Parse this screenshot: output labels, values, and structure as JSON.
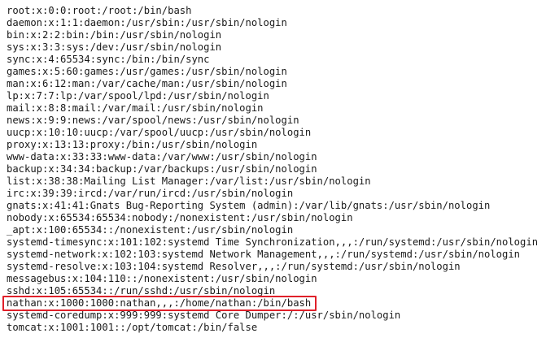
{
  "passwd_lines": [
    "root:x:0:0:root:/root:/bin/bash",
    "daemon:x:1:1:daemon:/usr/sbin:/usr/sbin/nologin",
    "bin:x:2:2:bin:/bin:/usr/sbin/nologin",
    "sys:x:3:3:sys:/dev:/usr/sbin/nologin",
    "sync:x:4:65534:sync:/bin:/bin/sync",
    "games:x:5:60:games:/usr/games:/usr/sbin/nologin",
    "man:x:6:12:man:/var/cache/man:/usr/sbin/nologin",
    "lp:x:7:7:lp:/var/spool/lpd:/usr/sbin/nologin",
    "mail:x:8:8:mail:/var/mail:/usr/sbin/nologin",
    "news:x:9:9:news:/var/spool/news:/usr/sbin/nologin",
    "uucp:x:10:10:uucp:/var/spool/uucp:/usr/sbin/nologin",
    "proxy:x:13:13:proxy:/bin:/usr/sbin/nologin",
    "www-data:x:33:33:www-data:/var/www:/usr/sbin/nologin",
    "backup:x:34:34:backup:/var/backups:/usr/sbin/nologin",
    "list:x:38:38:Mailing List Manager:/var/list:/usr/sbin/nologin",
    "irc:x:39:39:ircd:/var/run/ircd:/usr/sbin/nologin",
    "gnats:x:41:41:Gnats Bug-Reporting System (admin):/var/lib/gnats:/usr/sbin/nologin",
    "nobody:x:65534:65534:nobody:/nonexistent:/usr/sbin/nologin",
    "_apt:x:100:65534::/nonexistent:/usr/sbin/nologin",
    "systemd-timesync:x:101:102:systemd Time Synchronization,,,:/run/systemd:/usr/sbin/nologin",
    "systemd-network:x:102:103:systemd Network Management,,,:/run/systemd:/usr/sbin/nologin",
    "systemd-resolve:x:103:104:systemd Resolver,,,:/run/systemd:/usr/sbin/nologin",
    "messagebus:x:104:110::/nonexistent:/usr/sbin/nologin",
    "sshd:x:105:65534::/run/sshd:/usr/sbin/nologin",
    "nathan:x:1000:1000:nathan,,,:/home/nathan:/bin/bash",
    "systemd-coredump:x:999:999:systemd Core Dumper:/:/usr/sbin/nologin",
    "tomcat:x:1001:1001::/opt/tomcat:/bin/false"
  ],
  "highlight": {
    "line_index": 24,
    "color": "#e0202a"
  }
}
